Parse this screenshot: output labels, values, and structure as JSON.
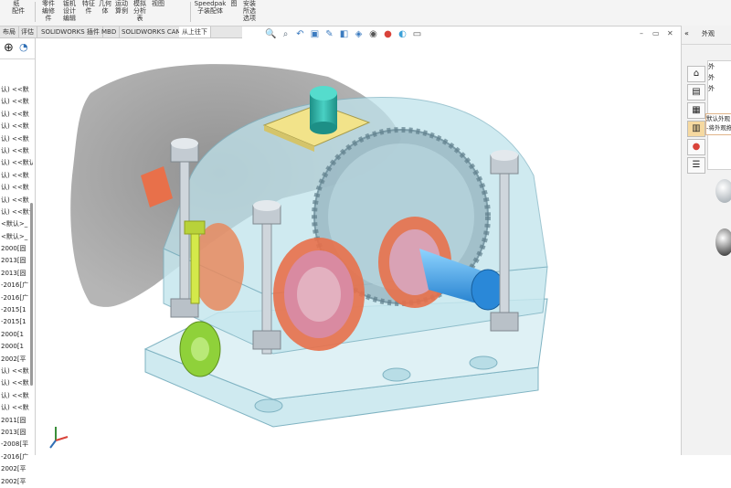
{
  "ribbon": {
    "items": [
      "纸 \n 配件",
      "零件\n编修\n件",
      "钣机\n设计\n编辑",
      "特征\n件",
      "几何\n体",
      "运动\n算例",
      "模拟\n分析\n表",
      "视图",
      "Speedpak\n子装配体",
      "图",
      "安装\n所选\n选项"
    ]
  },
  "tabs": [
    "布局",
    "评估",
    "SOLIDWORKS 插件",
    "MBD",
    "SOLIDWORKS CAM",
    "从上往下"
  ],
  "hud_icons": [
    "magnify-icon",
    "zoom-area-icon",
    "previous-view-icon",
    "section-view-icon",
    "dynamic-annotation-icon",
    "view-orientation-icon",
    "display-style-icon",
    "hide-show-icon",
    "appearance-icon",
    "scene-icon",
    "view-settings-icon"
  ],
  "left_panel": {
    "tree_items": [
      "认) <<默",
      "认) <<默",
      "认) <<默",
      "认) <<默",
      "认) <<默",
      "认) <<默",
      "认) <<默认",
      "认) <<默",
      "认) <<默",
      "认) <<默",
      "认) <<默认",
      "<默认>_",
      "<默认>_",
      "2000[固",
      "2013[固",
      "2013[固",
      "-2016[广",
      "-2016[广",
      "-2015[1",
      "-2015[1",
      "2000[1",
      "2000[1",
      "2002[平",
      "认) <<默",
      "认) <<默",
      "认) <<默",
      "认) <<默",
      "2011[固",
      "2013[固",
      "-2008[平",
      "-2016[广",
      "2002[平",
      "2002[平"
    ]
  },
  "task_pane": {
    "title": "外观",
    "items": [
      "外",
      "外",
      "外"
    ],
    "callout_line1": "默认外观",
    "callout_line2": "-将外观拖"
  },
  "colors": {
    "ribbon_bg": "#f4f4f4",
    "shadow": "#8c8c8c",
    "housing": "#bfe3ec",
    "gear": "#9bb9c4",
    "bearing": "#e8704a",
    "shaft_blue": "#3aa7e6",
    "green_flange": "#8fd13a",
    "teal_cap": "#2bb1a6",
    "yellow_plate": "#f2e38a"
  }
}
